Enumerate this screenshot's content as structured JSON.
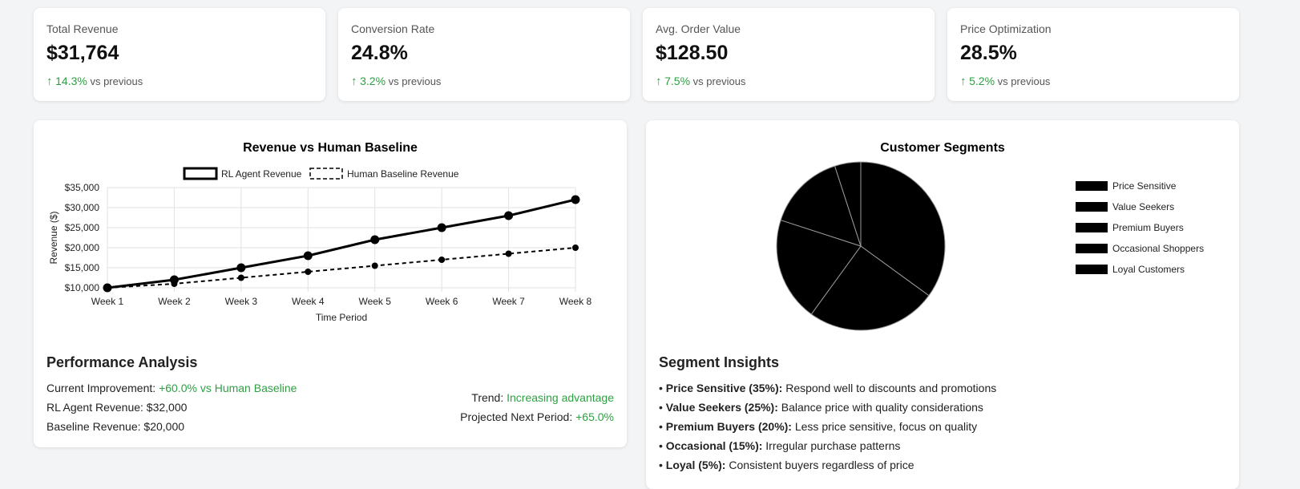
{
  "kpis": [
    {
      "label": "Total Revenue",
      "value": "$31,764",
      "change": "14.3%",
      "suffix": "vs previous"
    },
    {
      "label": "Conversion Rate",
      "value": "24.8%",
      "change": "3.2%",
      "suffix": "vs previous"
    },
    {
      "label": "Avg. Order Value",
      "value": "$128.50",
      "change": "7.5%",
      "suffix": "vs previous"
    },
    {
      "label": "Price Optimization",
      "value": "28.5%",
      "change": "5.2%",
      "suffix": "vs previous"
    }
  ],
  "revenue_chart": {
    "title": "Revenue vs Human Baseline"
  },
  "performance": {
    "title": "Performance Analysis",
    "current_improvement_label": "Current Improvement:",
    "current_improvement_value": "+60.0% vs Human Baseline",
    "rl_revenue_label": "RL Agent Revenue:",
    "rl_revenue_value": "$32,000",
    "baseline_label": "Baseline Revenue:",
    "baseline_value": "$20,000",
    "trend_label": "Trend:",
    "trend_value": "Increasing advantage",
    "projected_label": "Projected Next Period:",
    "projected_value": "+65.0%"
  },
  "segments_chart": {
    "title": "Customer Segments"
  },
  "insights": {
    "title": "Segment Insights",
    "items": [
      {
        "bold": "Price Sensitive (35%):",
        "text": "Respond well to discounts and promotions"
      },
      {
        "bold": "Value Seekers (25%):",
        "text": "Balance price with quality considerations"
      },
      {
        "bold": "Premium Buyers (20%):",
        "text": "Less price sensitive, focus on quality"
      },
      {
        "bold": "Occasional (15%):",
        "text": "Irregular purchase patterns"
      },
      {
        "bold": "Loyal (5%):",
        "text": "Consistent buyers regardless of price"
      }
    ]
  },
  "chart_data": [
    {
      "type": "line",
      "title": "Revenue vs Human Baseline",
      "categories": [
        "Week 1",
        "Week 2",
        "Week 3",
        "Week 4",
        "Week 5",
        "Week 6",
        "Week 7",
        "Week 8"
      ],
      "series": [
        {
          "name": "RL Agent Revenue",
          "values": [
            10000,
            12000,
            15000,
            18000,
            22000,
            25000,
            28000,
            32000
          ],
          "style": "solid"
        },
        {
          "name": "Human Baseline Revenue",
          "values": [
            10000,
            11000,
            12500,
            14000,
            15500,
            17000,
            18500,
            20000
          ],
          "style": "dashed"
        }
      ],
      "xlabel": "Time Period",
      "ylabel": "Revenue ($)",
      "ylim": [
        10000,
        35000
      ],
      "yticks": [
        "$10,000",
        "$15,000",
        "$20,000",
        "$25,000",
        "$30,000",
        "$35,000"
      ],
      "yticks_values": [
        10000,
        15000,
        20000,
        25000,
        30000,
        35000
      ],
      "grid": true,
      "legend": "top"
    },
    {
      "type": "pie",
      "title": "Customer Segments",
      "labels": [
        "Price Sensitive",
        "Value Seekers",
        "Premium Buyers",
        "Occasional Shoppers",
        "Loyal Customers"
      ],
      "values": [
        35,
        25,
        20,
        15,
        5
      ],
      "color": "#000000",
      "legend": "right"
    }
  ]
}
